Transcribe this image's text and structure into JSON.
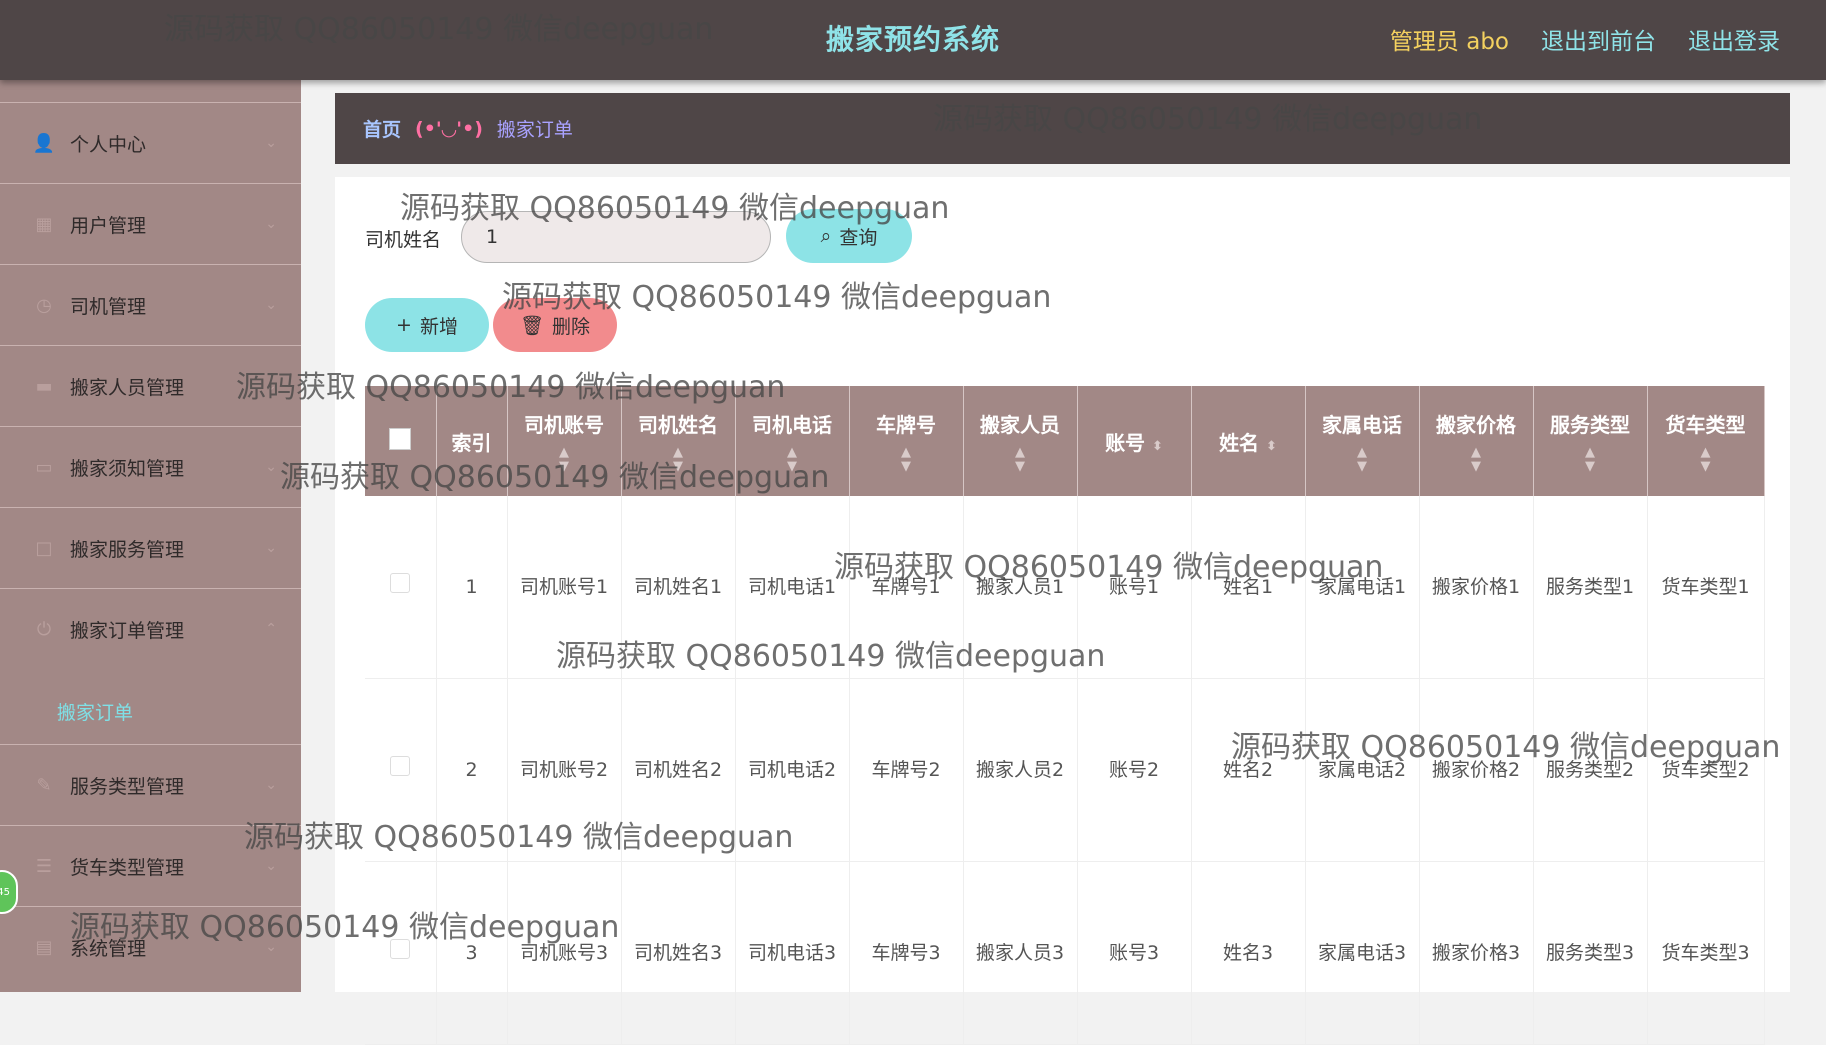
{
  "header": {
    "title": "搬家预约系统",
    "admin_label": "管理员 abo",
    "back_front_label": "退出到前台",
    "logout_label": "退出登录"
  },
  "sidebar": {
    "items": [
      {
        "label": "个人中心",
        "icon": "user-icon"
      },
      {
        "label": "用户管理",
        "icon": "grid-icon"
      },
      {
        "label": "司机管理",
        "icon": "clock-icon"
      },
      {
        "label": "搬家人员管理",
        "icon": "folder-icon"
      },
      {
        "label": "搬家须知管理",
        "icon": "briefcase-icon"
      },
      {
        "label": "搬家服务管理",
        "icon": "square-icon"
      },
      {
        "label": "搬家订单管理",
        "icon": "power-icon"
      },
      {
        "label": "服务类型管理",
        "icon": "edit-icon"
      },
      {
        "label": "货车类型管理",
        "icon": "list-icon"
      },
      {
        "label": "系统管理",
        "icon": "chat-icon"
      }
    ],
    "submenu_label": "搬家订单"
  },
  "breadcrumb": {
    "home": "首页",
    "separator": "(•'◡'•)",
    "current": "搬家订单"
  },
  "search": {
    "label": "司机姓名",
    "value": "1",
    "button_label": "查询"
  },
  "actions": {
    "add_label": "新增",
    "delete_label": "删除"
  },
  "table": {
    "columns": [
      "索引",
      "司机账号",
      "司机姓名",
      "司机电话",
      "车牌号",
      "搬家人员",
      "账号",
      "姓名",
      "家属电话",
      "搬家价格",
      "服务类型",
      "货车类型"
    ],
    "rows": [
      [
        "1",
        "司机账号1",
        "司机姓名1",
        "司机电话1",
        "车牌号1",
        "搬家人员1",
        "账号1",
        "姓名1",
        "家属电话1",
        "搬家价格1",
        "服务类型1",
        "货车类型1"
      ],
      [
        "2",
        "司机账号2",
        "司机姓名2",
        "司机电话2",
        "车牌号2",
        "搬家人员2",
        "账号2",
        "姓名2",
        "家属电话2",
        "搬家价格2",
        "服务类型2",
        "货车类型2"
      ],
      [
        "3",
        "司机账号3",
        "司机姓名3",
        "司机电话3",
        "车牌号3",
        "搬家人员3",
        "账号3",
        "姓名3",
        "家属电话3",
        "搬家价格3",
        "服务类型3",
        "货车类型3"
      ]
    ]
  },
  "watermark": "源码获取 QQ86050149 微信deepguan",
  "badge": "45",
  "colors": {
    "topbar": "#4f4647",
    "sidebar": "#a28886",
    "accent_cyan": "#8de3e6",
    "danger": "#f28b8d",
    "admin_yellow": "#f4d15f"
  }
}
